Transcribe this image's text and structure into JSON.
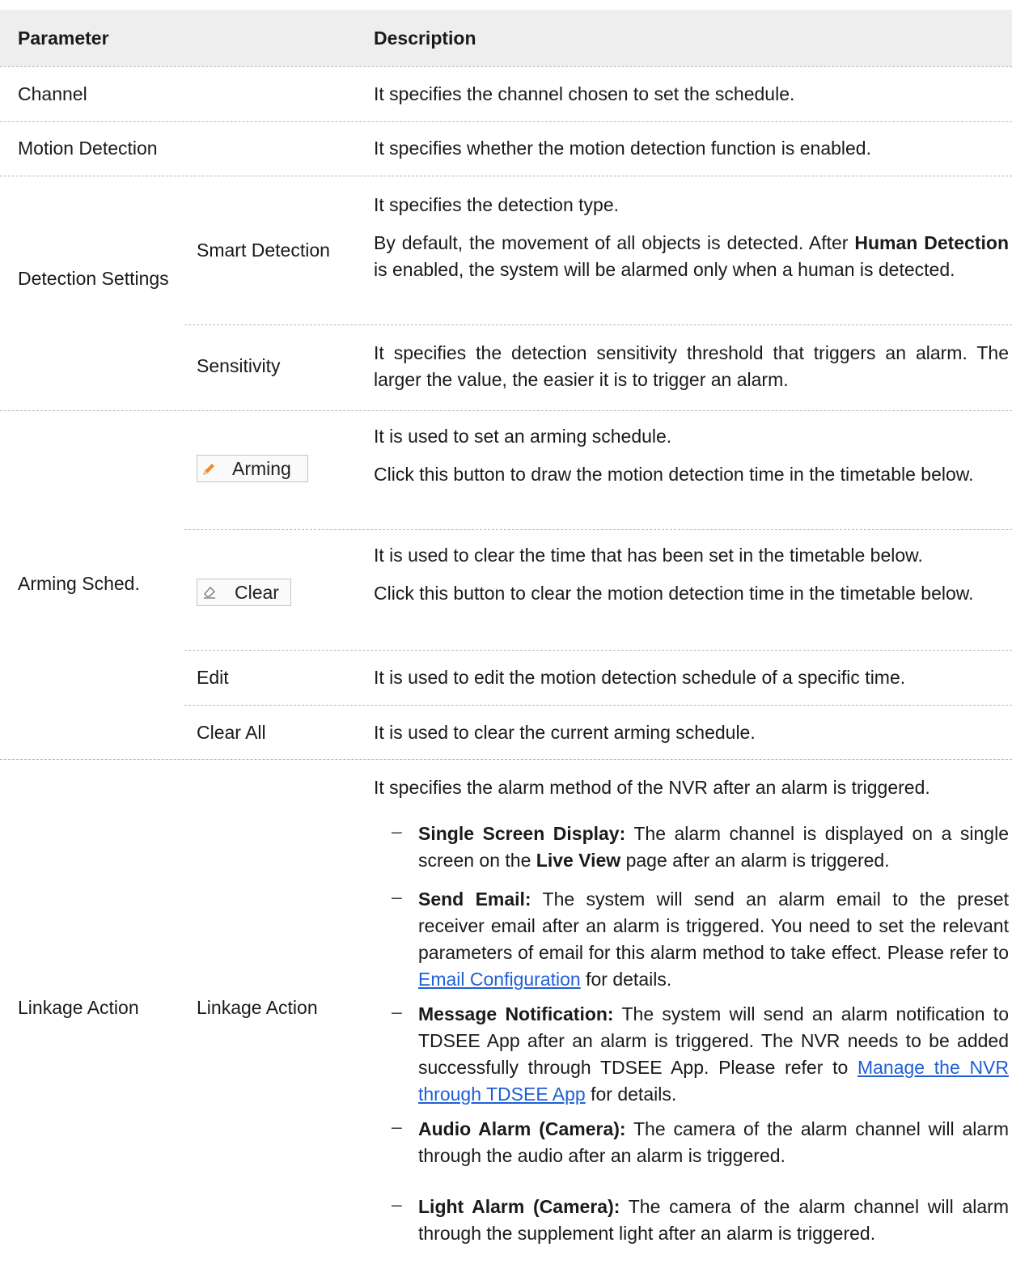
{
  "header": {
    "parameter": "Parameter",
    "description": "Description"
  },
  "rows": {
    "channel": {
      "name": "Channel",
      "desc": "It specifies the channel chosen to set the schedule."
    },
    "motion": {
      "name": "Motion Detection",
      "desc": "It specifies whether the motion detection function is enabled."
    },
    "detection": {
      "group": "Detection Settings",
      "smart": {
        "name": "Smart Detection",
        "desc1": "It specifies the detection type.",
        "desc2_pre": "By default, the movement of all objects is detected. After",
        "desc2_bold": "Human Detection",
        "desc2_post": "is enabled, the system will be alarmed only when a human is detected."
      },
      "sensitivity": {
        "name": "Sensitivity",
        "desc": "It specifies the detection sensitivity threshold that triggers an alarm. The larger the value, the easier it is to trigger an alarm."
      }
    },
    "arming": {
      "group": "Arming Sched.",
      "arming_btn": {
        "label": "Arming",
        "icon": "pencil-icon",
        "desc1": "It is used to set an arming schedule.",
        "desc2": "Click this button to draw the motion detection time in the timetable below."
      },
      "clear_btn": {
        "label": "Clear",
        "icon": "eraser-icon",
        "desc1": "It is used to clear the time that has been set in the timetable below.",
        "desc2": "Click this button to clear the motion detection time in the timetable below."
      },
      "edit": {
        "name": "Edit",
        "desc": "It is used to edit the motion detection schedule of a specific time."
      },
      "clear_all": {
        "name": "Clear All",
        "desc": "It is used to clear the current arming schedule."
      }
    },
    "linkage": {
      "group": "Linkage Action",
      "name": "Linkage Action",
      "intro": "It specifies the alarm method of the NVR after an alarm is triggered.",
      "bullet_mark": "–",
      "single": {
        "title": "Single Screen Display:",
        "pre": "The alarm channel is displayed on a single screen on the",
        "bold": "Live View",
        "post": "page after an alarm is triggered."
      },
      "email": {
        "title": "Send Email:",
        "text": "The system will send an alarm email to the preset receiver email after an alarm is triggered. You need to set the relevant parameters of email for this alarm method to take effect. Please refer to",
        "link": "Email Configuration",
        "post": "for details."
      },
      "message": {
        "title": "Message Notification:",
        "text": "The system will send an alarm notification to TDSEE App after an alarm is triggered. The NVR needs to be added successfully through TDSEE App. Please refer to",
        "link": "Manage the NVR through TDSEE App",
        "post": "for details."
      },
      "audio": {
        "title": "Audio Alarm (Camera):",
        "text": "The camera of the alarm channel will alarm through the audio after an alarm is triggered."
      },
      "light": {
        "title": "Light Alarm (Camera):",
        "text": "The camera of the alarm channel will alarm through the supplement light after an alarm is triggered."
      }
    }
  },
  "colors": {
    "header_bg": "#eeeeee",
    "link": "#1f5fd6",
    "divider": "#b8b8b8",
    "pencil": "#f08a24"
  }
}
